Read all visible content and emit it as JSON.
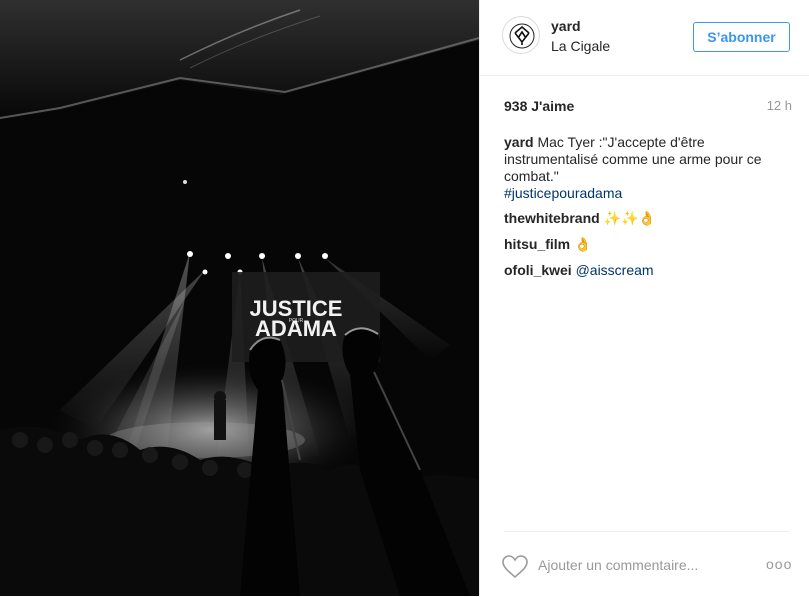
{
  "post": {
    "username": "yard",
    "location": "La Cigale",
    "follow_label": "S’abonner",
    "likes": "938 J'aime",
    "time": "12 h",
    "caption": {
      "author": "yard",
      "text": " Mac Tyer :\"J'accepte d'être instrumentalisé comme une arme pour ce combat.\"",
      "hashtag": "#justicepouradama"
    },
    "comments": [
      {
        "author": "thewhitebrand",
        "text": "✨✨👌"
      },
      {
        "author": "hitsu_film",
        "text": "👌"
      },
      {
        "author": "ofoli_kwei",
        "text": "@aisscream"
      }
    ],
    "comment_placeholder": "Ajouter un commentaire...",
    "more_label": "ooo"
  },
  "photo": {
    "screen_title_line1": "JUSTICE",
    "screen_title_small": "POUR",
    "screen_title_line2": "ADAMA"
  },
  "colors": {
    "accent": "#3897f0",
    "link": "#003569",
    "muted": "#999999"
  },
  "icons": {
    "avatar": "yard-logo-icon",
    "like": "heart-icon",
    "more": "more-dots-icon"
  }
}
